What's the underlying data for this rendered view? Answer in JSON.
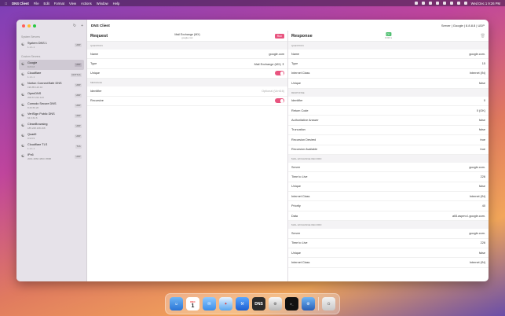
{
  "menubar": {
    "app_name": "DNS Client",
    "menus": [
      "File",
      "Edit",
      "Format",
      "View",
      "Actions",
      "Window",
      "Help"
    ],
    "clock": "Wed Dec 1  9:26 PM"
  },
  "window": {
    "title": "DNS Client",
    "server_info": "Server | Google | 8.8.8.8 | UDP"
  },
  "sidebar": {
    "system_section": "System Servers",
    "system_items": [
      {
        "name": "System DNS 1",
        "address": "1.1.1.1",
        "protocol": "UDP"
      }
    ],
    "custom_section": "Custom Servers",
    "custom_items": [
      {
        "name": "Google",
        "address": "8.8.8.8",
        "protocol": "UDP",
        "selected": true
      },
      {
        "name": "Cloudflare",
        "address": "1.1.1.1",
        "protocol": "DOTTLS"
      },
      {
        "name": "Norton ConnectSafe DNS",
        "address": "199.85.126.10",
        "protocol": "UDP"
      },
      {
        "name": "OpenDNS",
        "address": "208.67.222.123",
        "protocol": "UDP"
      },
      {
        "name": "Comodo Secure DNS",
        "address": "8.26.56.26",
        "protocol": "UDP"
      },
      {
        "name": "VeriSign Public DNS",
        "address": "64.6.64.6",
        "protocol": "UDP"
      },
      {
        "name": "CleanBrowsing",
        "address": "185.228.168.168",
        "protocol": "UDP"
      },
      {
        "name": "Quad9",
        "address": "9.9.9.9",
        "protocol": "UDP"
      },
      {
        "name": "Cloudflare TLS",
        "address": "1.1.1.1",
        "protocol": "TLS"
      },
      {
        "name": "IPv6",
        "address": "2001:4860:4860::8888",
        "protocol": "UDP"
      }
    ]
  },
  "request": {
    "title": "Request",
    "summary_type": "Mail Exchange (MX)",
    "summary_domain": "google.com",
    "run_label": "Run",
    "question_header": "QUESTION",
    "name_label": "Name",
    "name_value": "google.com",
    "type_label": "Type",
    "type_value": "Mail Exchange (MX)",
    "unique_label": "Unique",
    "message_header": "MESSAGE",
    "identifier_label": "Identifier",
    "identifier_placeholder": "Optional (UInt16)",
    "recursive_label": "Recursive"
  },
  "response": {
    "title": "Response",
    "status": "OK",
    "latency": "0.023 s",
    "sections": [
      {
        "header": "QUESTION",
        "rows": [
          {
            "k": "Name",
            "v": "google.com."
          },
          {
            "k": "Type",
            "v": "15"
          },
          {
            "k": "Internet Class",
            "v": "Internet (IN)"
          },
          {
            "k": "Unique",
            "v": "false"
          }
        ]
      },
      {
        "header": "RESPONSE",
        "rows": [
          {
            "k": "Identifier",
            "v": "0"
          },
          {
            "k": "Return Code",
            "v": "0 (OK)"
          },
          {
            "k": "Authoritative Answer",
            "v": "false"
          },
          {
            "k": "Truncation",
            "v": "false"
          },
          {
            "k": "Recursion Desired",
            "v": "true"
          },
          {
            "k": "Recursion Available",
            "v": "true"
          }
        ]
      },
      {
        "header": "MAIL EXCHANGE RECORD",
        "rows": [
          {
            "k": "Server",
            "v": "google.com."
          },
          {
            "k": "Time to Live",
            "v": "226"
          },
          {
            "k": "Unique",
            "v": "false"
          },
          {
            "k": "Internet Class",
            "v": "Internet (IN)"
          },
          {
            "k": "Priority",
            "v": "40"
          },
          {
            "k": "Data",
            "v": "alt3.aspmx.l.google.com."
          }
        ]
      },
      {
        "header": "MAIL EXCHANGE RECORD",
        "rows": [
          {
            "k": "Server",
            "v": "google.com."
          },
          {
            "k": "Time to Live",
            "v": "226"
          },
          {
            "k": "Unique",
            "v": "false"
          },
          {
            "k": "Internet Class",
            "v": "Internet (IN)"
          }
        ]
      }
    ]
  },
  "dock": {
    "calendar_month": "DEC",
    "calendar_day": "1",
    "dns_label": "DNS"
  },
  "colors": {
    "accent": "#e8547f",
    "ok": "#4fbf70"
  }
}
